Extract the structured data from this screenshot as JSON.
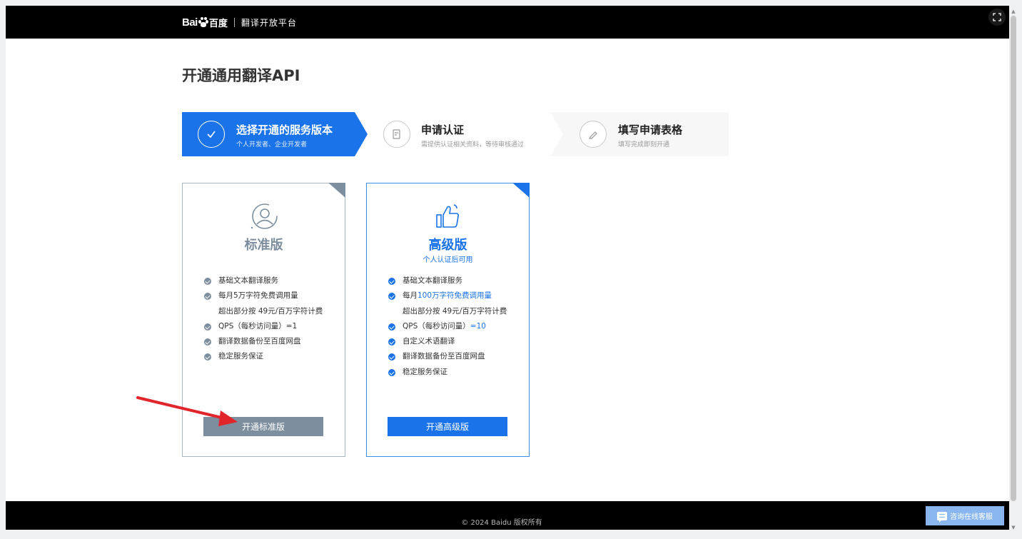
{
  "header": {
    "logo_bai": "Bai",
    "logo_cn": "百度",
    "platform": "翻译开放平台",
    "expand_icon": "expand-icon"
  },
  "page_title": "开通通用翻译API",
  "steps": [
    {
      "title": "选择开通的服务版本",
      "subtitle": "个人开发者、企业开发者",
      "icon": "check-circle-icon",
      "state": "active"
    },
    {
      "title": "申请认证",
      "subtitle": "需提供认证相关资料，等待审核通过",
      "icon": "document-edit-icon",
      "state": "pending"
    },
    {
      "title": "填写申请表格",
      "subtitle": "填写完成即刻开通",
      "icon": "pencil-icon",
      "state": "pending"
    }
  ],
  "plans": {
    "standard": {
      "title": "标准版",
      "icon": "user-icon",
      "features": [
        {
          "text": "基础文本翻译服务",
          "bullet": true
        },
        {
          "text": "每月5万字符免费调用量",
          "bullet": true
        },
        {
          "text": "超出部分按 49元/百万字符计费",
          "bullet": false
        },
        {
          "text": "QPS（每秒访问量）=1",
          "bullet": true
        },
        {
          "text": "翻译数据备份至百度网盘",
          "bullet": true
        },
        {
          "text": "稳定服务保证",
          "bullet": true
        }
      ],
      "button": "开通标准版"
    },
    "advanced": {
      "title": "高级版",
      "subtitle": "个人认证后可用",
      "icon": "thumbs-up-icon",
      "f1": "基础文本翻译服务",
      "f2_pre": "每月",
      "f2_hl": "100万字符免费调用量",
      "f3": "超出部分按 49元/百万字符计费",
      "f4_pre": "QPS（每秒访问量）",
      "f4_hl": "=10",
      "f5": "自定义术语翻译",
      "f6": "翻译数据备份至百度网盘",
      "f7": "稳定服务保证",
      "button": "开通高级版"
    }
  },
  "footer": {
    "copyright": "© 2024 Baidu 版权所有",
    "chat_label": "咨询在线客服"
  },
  "colors": {
    "primary": "#1a73e8",
    "standard_gray": "#7d8e9e",
    "annotation_arrow": "#e0262b"
  }
}
